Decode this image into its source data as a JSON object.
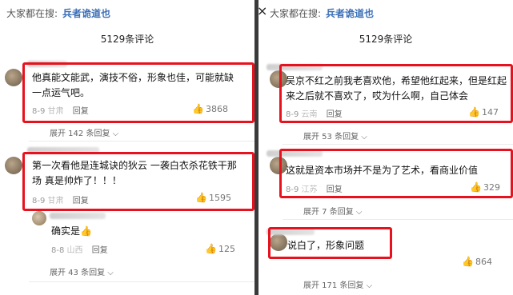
{
  "left": {
    "search_prefix": "大家都在搜:",
    "search_term": "兵者诡道也",
    "close_icon": "×",
    "comment_count": "5129条评论",
    "comments": [
      {
        "text": "他真能文能武，演技不俗，形象也佳，可能就缺一点运气吧。",
        "date": "8-9",
        "location": "甘肃",
        "reply_label": "回复",
        "likes": "3868",
        "expand": "展开 142 条回复"
      },
      {
        "text": "第一次看他是连城诀的狄云 一袭白衣杀花铁干那场 真是帅炸了！！！",
        "date": "8-9",
        "location": "甘肃",
        "reply_label": "回复",
        "likes": "1595"
      }
    ],
    "sub_reply": {
      "text": "确实是",
      "date": "8-8",
      "location": "山西",
      "reply_label": "回复",
      "likes": "125"
    },
    "expand_2": "展开 43 条回复"
  },
  "right": {
    "search_prefix": "大家都在搜:",
    "search_term": "兵者诡道也",
    "comment_count": "5129条评论",
    "comments": [
      {
        "text": "吴京不红之前我老喜欢他，希望他红起来，但是红起来之后就不喜欢了，哎为什么啊，自己体会",
        "date": "8-9",
        "location": "云南",
        "reply_label": "回复",
        "likes": "147",
        "expand": "展开 53 条回复"
      },
      {
        "text": "这就是资本市场并不是为了艺术，看商业价值",
        "date": "8-9",
        "location": "江苏",
        "reply_label": "回复",
        "likes": "329",
        "expand": "展开 7 条回复"
      },
      {
        "text": "说白了，形象问题",
        "likes": "864",
        "expand": "展开 171 条回复"
      }
    ]
  },
  "colors": {
    "highlight": "#e8121e",
    "search_term": "#3b6fb6"
  }
}
